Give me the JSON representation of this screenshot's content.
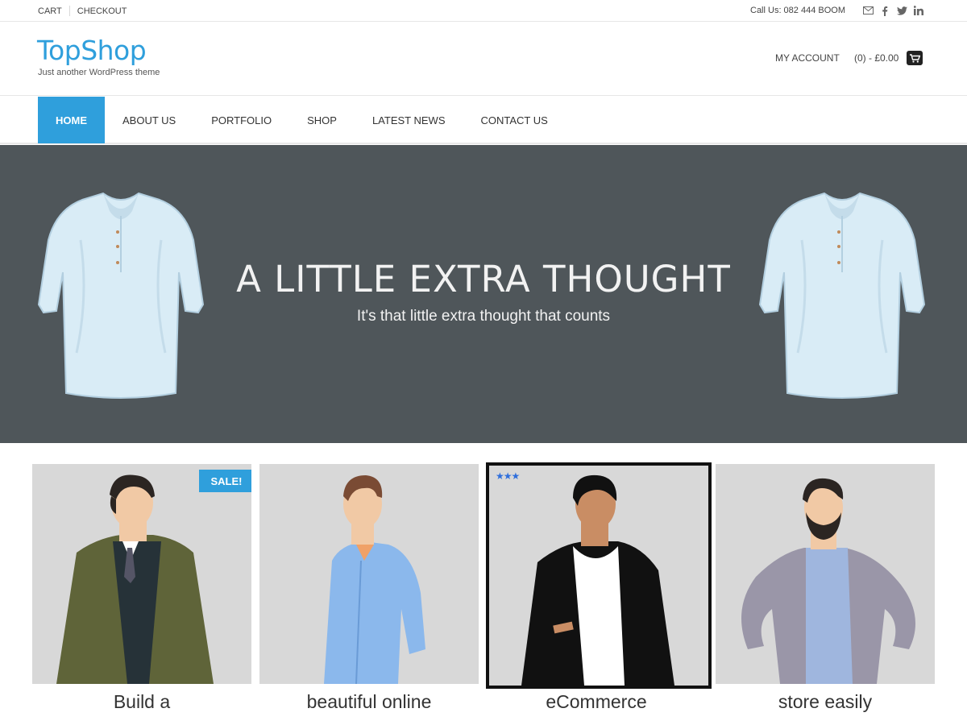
{
  "topbar": {
    "links": [
      "CART",
      "CHECKOUT"
    ],
    "call_text": "Call Us: 082 444 BOOM",
    "social_icons": [
      "envelope-icon",
      "facebook-icon",
      "twitter-icon",
      "linkedin-icon"
    ]
  },
  "header": {
    "logo": "TopShop",
    "tagline": "Just another WordPress theme",
    "account_label": "MY ACCOUNT",
    "cart_text": "(0) - £0.00",
    "cart_icon": "shopping-cart-icon"
  },
  "nav": {
    "items": [
      "HOME",
      "ABOUT US",
      "PORTFOLIO",
      "SHOP",
      "LATEST NEWS",
      "CONTACT US"
    ],
    "active": "HOME"
  },
  "hero": {
    "title": "A LITTLE EXTRA THOUGHT",
    "subtitle": "It's that little extra thought that counts"
  },
  "products": [
    {
      "label": "Build a",
      "badge": "SALE!"
    },
    {
      "label": "beautiful online"
    },
    {
      "label": "eCommerce",
      "rating_stars": "★★★",
      "rating": 3
    },
    {
      "label": "store easily"
    }
  ],
  "colors": {
    "accent": "#2f9fdc",
    "hero_bg": "#4f565a",
    "card_bg": "#d8d8d8"
  }
}
